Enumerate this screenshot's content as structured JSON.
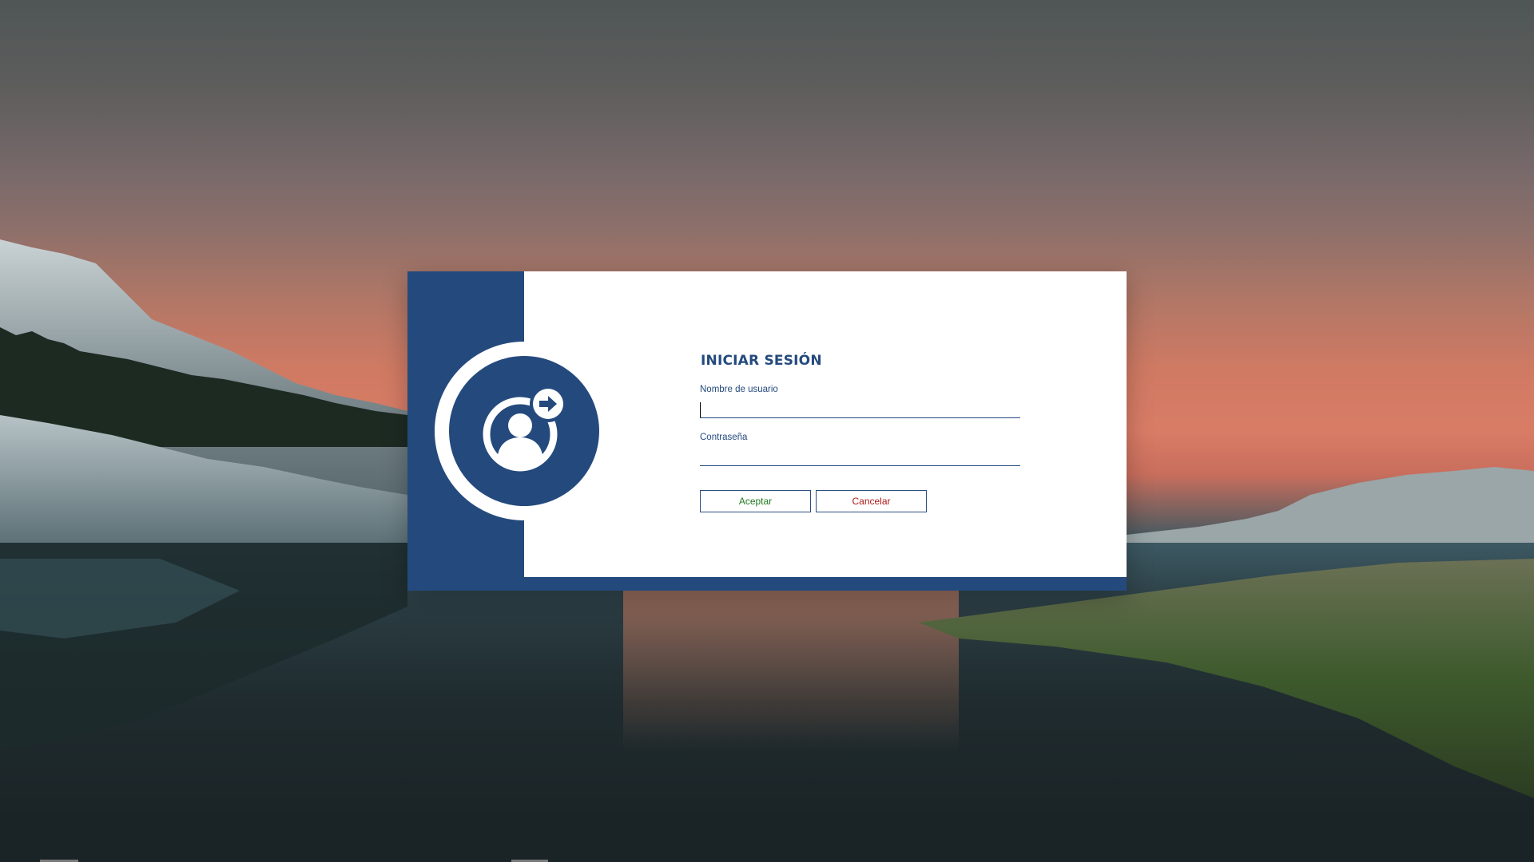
{
  "window": {
    "title": "INICIAR SESIÓN"
  },
  "form": {
    "username": {
      "label": "Nombre de usuario",
      "value": ""
    },
    "password": {
      "label": "Contraseña",
      "value": ""
    },
    "buttons": {
      "accept_label": "Aceptar",
      "cancel_label": "Cancelar"
    }
  },
  "icons": {
    "avatar": "user-login-icon",
    "arrow": "arrow-right-icon"
  },
  "colors": {
    "brand": "#244a7d",
    "accept_text": "#1e7a1e",
    "cancel_text": "#b01818",
    "panel_background": "#ffffff"
  }
}
